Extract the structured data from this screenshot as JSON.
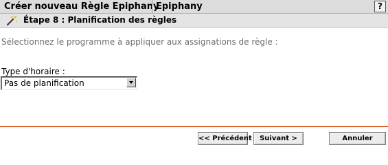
{
  "header": {
    "wizard_title": "Créer nouveau Règle Epiphany",
    "app_name": "Epiphany",
    "help_label": "?"
  },
  "step": {
    "title": "Étape 8 : Planification des règles",
    "icon": "magic-wand-icon"
  },
  "content": {
    "instruction": "Sélectionnez le programme à appliquer aux assignations de règle :",
    "schedule_type_label": "Type d'horaire :",
    "schedule_type_value": "Pas de planification"
  },
  "buttons": {
    "previous": "<< Précédent",
    "next": "Suivant >",
    "cancel": "Annuler"
  },
  "colors": {
    "divider": "#d9682a",
    "titlebar_bg": "#dcdcdc"
  }
}
